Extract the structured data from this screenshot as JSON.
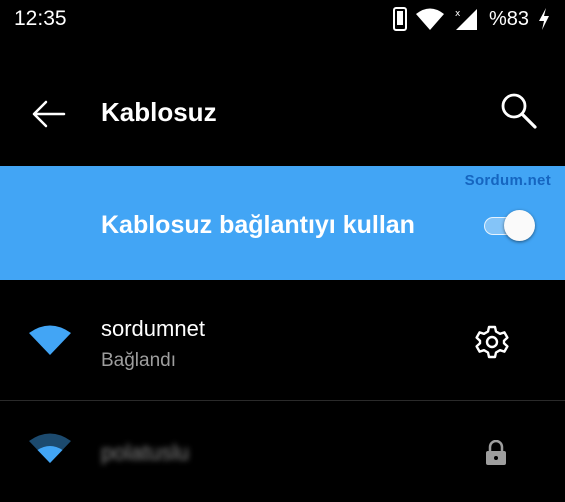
{
  "status_bar": {
    "time": "12:35",
    "battery": "%83",
    "icons": [
      "phone-icon",
      "wifi-signal-icon",
      "cell-signal-icon",
      "charging-bolt-icon"
    ]
  },
  "app_bar": {
    "title": "Kablosuz",
    "back_icon": "arrow-left-icon",
    "search_icon": "search-icon"
  },
  "wifi_toggle": {
    "label": "Kablosuz bağlantıyı kullan",
    "watermark": "Sordum.net",
    "enabled": true,
    "background": "#42A5F5"
  },
  "networks": [
    {
      "name": "sordumnet",
      "status": "Bağlandı",
      "connected": true,
      "action_icon": "gear-icon",
      "signal": "full"
    },
    {
      "name": "polatuslu",
      "status": "",
      "connected": false,
      "action_icon": "lock-icon",
      "signal": "medium"
    }
  ],
  "colors": {
    "accent": "#42A5F5",
    "background": "#000000",
    "secondary_text": "#9E9E9E"
  }
}
